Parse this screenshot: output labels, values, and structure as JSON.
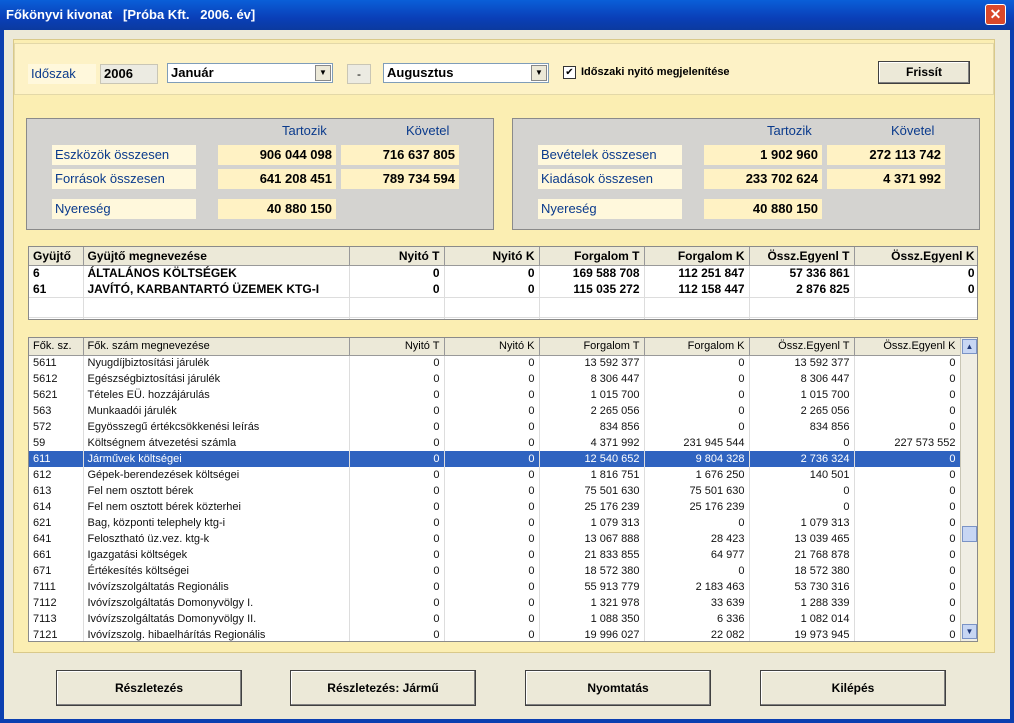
{
  "window": {
    "title": "Főkönyvi kivonat   [Próba Kft.   2006. év]",
    "close_glyph": "✕"
  },
  "filter": {
    "label": "Időszak",
    "year": "2006",
    "from_month": "Január",
    "dash": "-",
    "to_month": "Augusztus",
    "checkbox_checked": "✔",
    "checkbox_label": "Időszaki nyitó megjelenítése",
    "refresh_label": "Frissít"
  },
  "summary_left": {
    "col1": "Tartozik",
    "col2": "Követel",
    "row1_label": "Eszközök összesen",
    "row1_t": "906 044 098",
    "row1_k": "716 637 805",
    "row2_label": "Források összesen",
    "row2_t": "641 208 451",
    "row2_k": "789 734 594",
    "profit_label": "Nyereség",
    "profit": "40 880 150"
  },
  "summary_right": {
    "col1": "Tartozik",
    "col2": "Követel",
    "row1_label": "Bevételek összesen",
    "row1_t": "1 902 960",
    "row1_k": "272 113 742",
    "row2_label": "Kiadások összesen",
    "row2_t": "233 702 624",
    "row2_k": "4 371 992",
    "profit_label": "Nyereség",
    "profit": "40 880 150"
  },
  "collector_table": {
    "headers": [
      "Gyüjtő",
      "Gyüjtő megnevezése",
      "Nyitó T",
      "Nyitó K",
      "Forgalom T",
      "Forgalom K",
      "Össz.Egyenl T",
      "Össz.Egyenl K"
    ],
    "rows": [
      [
        "6",
        "ÁLTALÁNOS KÖLTSÉGEK",
        "0",
        "0",
        "169 588 708",
        "112 251 847",
        "57 336 861",
        "0"
      ],
      [
        "61",
        "JAVÍTÓ, KARBANTARTÓ ÜZEMEK KTG-I",
        "0",
        "0",
        "115 035 272",
        "112 158 447",
        "2 876 825",
        "0"
      ]
    ]
  },
  "account_table": {
    "headers": [
      "Fők. sz.",
      "Fők. szám megnevezése",
      "Nyitó T",
      "Nyitó K",
      "Forgalom T",
      "Forgalom K",
      "Össz.Egyenl T",
      "Össz.Egyenl K"
    ],
    "selected_index": 6,
    "rows": [
      [
        "5611",
        "Nyugdíjbiztosítási járulék",
        "0",
        "0",
        "13 592 377",
        "0",
        "13 592 377",
        "0"
      ],
      [
        "5612",
        "Egészségbiztosítási járulék",
        "0",
        "0",
        "8 306 447",
        "0",
        "8 306 447",
        "0"
      ],
      [
        "5621",
        "Tételes EÜ. hozzájárulás",
        "0",
        "0",
        "1 015 700",
        "0",
        "1 015 700",
        "0"
      ],
      [
        "563",
        "Munkaadói járulék",
        "0",
        "0",
        "2 265 056",
        "0",
        "2 265 056",
        "0"
      ],
      [
        "572",
        "Egyösszegű értékcsökkenési leírás",
        "0",
        "0",
        "834 856",
        "0",
        "834 856",
        "0"
      ],
      [
        "59",
        "Költségnem átvezetési számla",
        "0",
        "0",
        "4 371 992",
        "231 945 544",
        "0",
        "227 573 552"
      ],
      [
        "611",
        "Járművek költségei",
        "0",
        "0",
        "12 540 652",
        "9 804 328",
        "2 736 324",
        "0"
      ],
      [
        "612",
        "Gépek-berendezések költségei",
        "0",
        "0",
        "1 816 751",
        "1 676 250",
        "140 501",
        "0"
      ],
      [
        "613",
        "Fel nem osztott bérek",
        "0",
        "0",
        "75 501 630",
        "75 501 630",
        "0",
        "0"
      ],
      [
        "614",
        "Fel nem osztott bérek közterhei",
        "0",
        "0",
        "25 176 239",
        "25 176 239",
        "0",
        "0"
      ],
      [
        "621",
        "Bag, központi telephely ktg-i",
        "0",
        "0",
        "1 079 313",
        "0",
        "1 079 313",
        "0"
      ],
      [
        "641",
        "Felosztható üz.vez. ktg-k",
        "0",
        "0",
        "13 067 888",
        "28 423",
        "13 039 465",
        "0"
      ],
      [
        "661",
        "Igazgatási költségek",
        "0",
        "0",
        "21 833 855",
        "64 977",
        "21 768 878",
        "0"
      ],
      [
        "671",
        "Értékesítés költségei",
        "0",
        "0",
        "18 572 380",
        "0",
        "18 572 380",
        "0"
      ],
      [
        "7111",
        "Ivóvízszolgáltatás   Regionális",
        "0",
        "0",
        "55 913 779",
        "2 183 463",
        "53 730 316",
        "0"
      ],
      [
        "7112",
        "Ivóvízszolgáltatás   Domonyvölgy I.",
        "0",
        "0",
        "1 321 978",
        "33 639",
        "1 288 339",
        "0"
      ],
      [
        "7113",
        "Ivóvízszolgáltatás   Domonyvölgy II.",
        "0",
        "0",
        "1 088 350",
        "6 336",
        "1 082 014",
        "0"
      ],
      [
        "7121",
        "Ivóvízszolg. hibaelhárítás  Regionális",
        "0",
        "0",
        "19 996 027",
        "22 082",
        "19 973 945",
        "0"
      ]
    ]
  },
  "scrollbar": {
    "up_glyph": "▲",
    "down_glyph": "▼"
  },
  "footer": {
    "btn1": "Részletezés",
    "btn2": "Részletezés: Jármű",
    "btn3": "Nyomtatás",
    "btn4": "Kilépés"
  }
}
